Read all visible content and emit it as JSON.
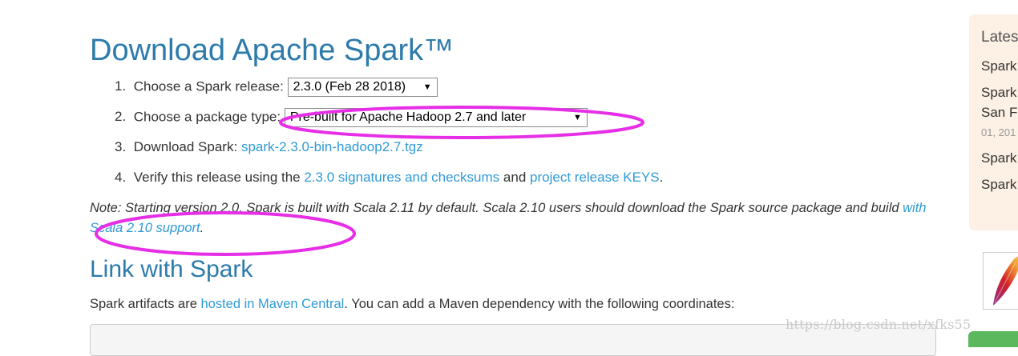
{
  "page": {
    "title": "Download Apache Spark™"
  },
  "steps": [
    {
      "num": "1.",
      "label": "Choose a Spark release:",
      "selected": "2.3.0 (Feb 28 2018)"
    },
    {
      "num": "2.",
      "label": "Choose a package type:",
      "selected": "Pre-built for Apache Hadoop 2.7 and later"
    },
    {
      "num": "3.",
      "label": "Download Spark:",
      "link": "spark-2.3.0-bin-hadoop2.7.tgz"
    },
    {
      "num": "4.",
      "label": "Verify this release using the",
      "link1": "2.3.0 signatures and checksums",
      "mid": "and",
      "link2": "project release KEYS",
      "end": "."
    }
  ],
  "note": {
    "text": "Note: Starting version 2.0, Spark is built with Scala 2.11 by default. Scala 2.10 users should download the Spark source package and build",
    "link": "with Scala 2.10 support",
    "end": "."
  },
  "link_section": {
    "title": "Link with Spark",
    "before": "Spark artifacts are",
    "link": "hosted in Maven Central",
    "after": ". You can add a Maven dependency with the following coordinates:"
  },
  "sidebar": {
    "title": "Lates",
    "items": [
      "Spark",
      "Spark",
      "San F",
      "Spark",
      "Spark"
    ],
    "date": "01, 201"
  },
  "watermark": "https://blog.csdn.net/xfks55",
  "colors": {
    "heading": "#2c7bab",
    "link": "#2f9ad5",
    "annotation": "#e62ee6",
    "sidebar_bg": "#fdf0e4"
  },
  "icons": {
    "logo": "apache-feather-icon",
    "dropdown": "dropdown-arrow-icon"
  }
}
